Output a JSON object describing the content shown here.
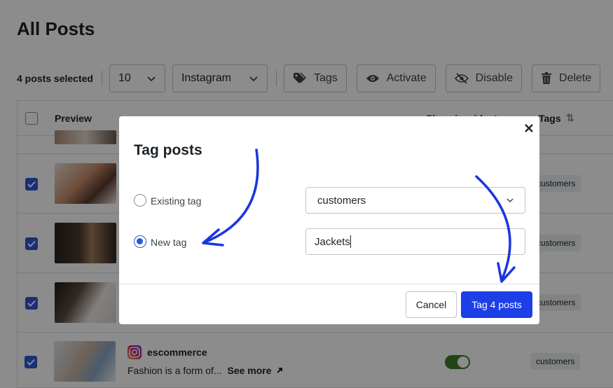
{
  "page": {
    "title": "All Posts"
  },
  "toolbar": {
    "selected_text": "4 posts selected",
    "per_page": "10",
    "source": "Instagram",
    "tags_label": "Tags",
    "activate_label": "Activate",
    "disable_label": "Disable",
    "delete_label": "Delete"
  },
  "table": {
    "headers": {
      "preview": "Preview",
      "widget": "Show in widget",
      "tags": "Tags"
    },
    "rows": [
      {
        "tag": "customers",
        "checked": true
      },
      {
        "tag": "customers",
        "checked": true
      },
      {
        "tag": "customers",
        "checked": true
      },
      {
        "tag": "customers",
        "checked": true,
        "account": "escommerce",
        "caption": "Fashion is a form of...",
        "see_more": "See more",
        "widget_enabled": true
      }
    ]
  },
  "modal": {
    "title": "Tag posts",
    "existing_tag_label": "Existing tag",
    "existing_tag_value": "customers",
    "new_tag_label": "New tag",
    "new_tag_value": "Jackets",
    "selected_option": "new",
    "cancel_label": "Cancel",
    "submit_label": "Tag 4 posts"
  },
  "colors": {
    "accent": "#1d3fe8",
    "checkbox": "#2f57d8",
    "annotation_arrow": "#1a35e0",
    "toggle_on": "#3f7f2a"
  }
}
